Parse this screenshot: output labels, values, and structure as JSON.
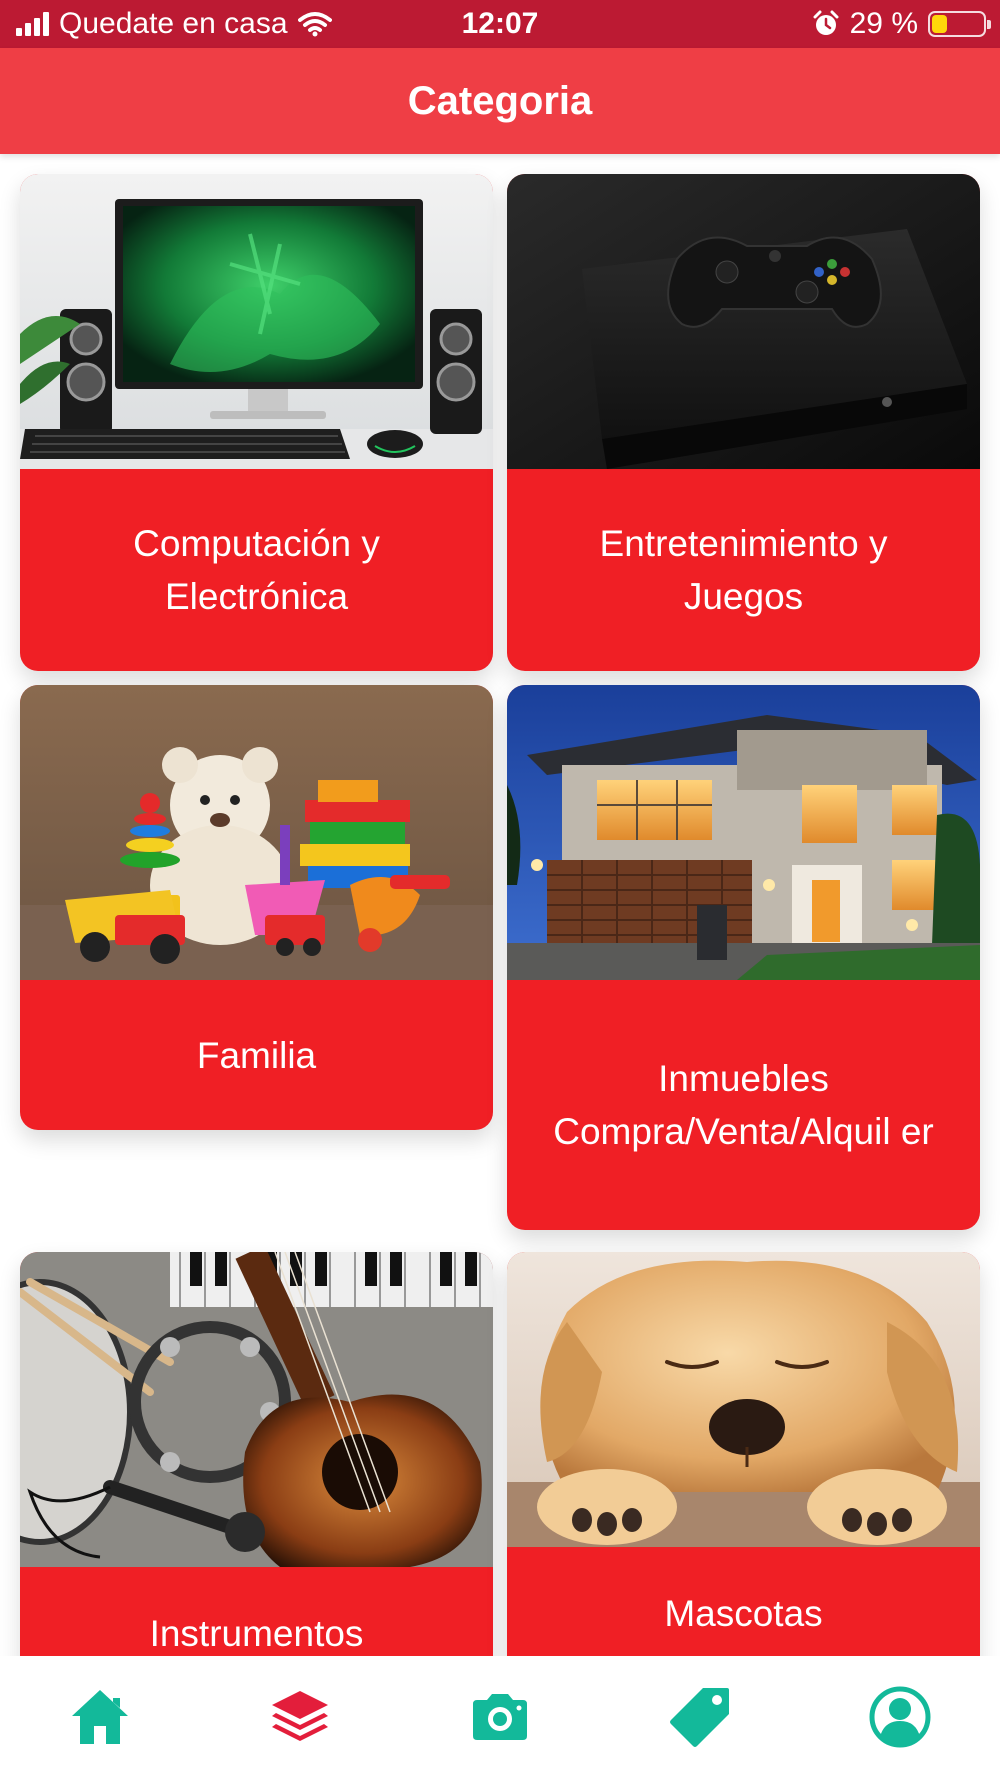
{
  "status": {
    "carrier": "Quedate en casa",
    "time": "12:07",
    "battery": "29 %",
    "battery_level": 0.29
  },
  "header": {
    "title": "Categoria"
  },
  "categories": [
    {
      "label": "Computación y Electrónica",
      "icon": "computer-desk-photo"
    },
    {
      "label": "Entretenimiento y Juegos",
      "icon": "game-console-photo"
    },
    {
      "label": "Familia",
      "icon": "toys-photo"
    },
    {
      "label": "Inmuebles Compra/Venta/Alquil er",
      "icon": "house-photo"
    },
    {
      "label": "Instrumentos",
      "icon": "instruments-photo"
    },
    {
      "label": "Mascotas",
      "icon": "puppy-photo"
    }
  ],
  "tabbar": [
    {
      "name": "home-icon",
      "color": "#13b99a"
    },
    {
      "name": "layers-icon",
      "color": "#e31e3b"
    },
    {
      "name": "camera-icon",
      "color": "#13b99a"
    },
    {
      "name": "tag-icon",
      "color": "#13b99a"
    },
    {
      "name": "user-icon",
      "color": "#13b99a"
    }
  ]
}
